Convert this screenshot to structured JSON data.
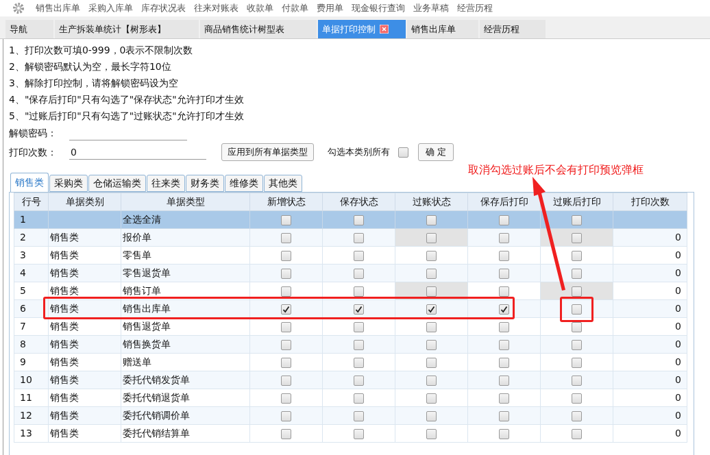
{
  "menu": [
    "销售出库单",
    "采购入库单",
    "库存状况表",
    "往来对账表",
    "收款单",
    "付款单",
    "费用单",
    "现金银行查询",
    "业务草稿",
    "经营历程"
  ],
  "tabs": [
    {
      "label": "导航",
      "selected": false,
      "closable": false
    },
    {
      "label": "生产拆装单统计【树形表】",
      "selected": false,
      "closable": false
    },
    {
      "label": "商品销售统计树型表",
      "selected": false,
      "closable": false
    },
    {
      "label": "单据打印控制",
      "selected": true,
      "closable": true
    },
    {
      "label": "销售出库单",
      "selected": false,
      "closable": false
    },
    {
      "label": "经营历程",
      "selected": false,
      "closable": false
    }
  ],
  "notes": [
    "1、打印次数可填0-999，0表示不限制次数",
    "2、解锁密码默认为空，最长字符10位",
    "3、解除打印控制，请将解锁密码设为空",
    "4、\"保存后打印\"只有勾选了\"保存状态\"允许打印才生效",
    "5、\"过账后打印\"只有勾选了\"过账状态\"允许打印才生效"
  ],
  "password": {
    "label": "解锁密码："
  },
  "print_count": {
    "label": "打印次数：",
    "value": "0"
  },
  "apply_button": "应用到所有单据类型",
  "select_all": {
    "label": "勾选本类别所有",
    "checked": false
  },
  "ok_button": "确 定",
  "category_tabs": [
    {
      "label": "销售类",
      "selected": true
    },
    {
      "label": "采购类",
      "selected": false
    },
    {
      "label": "仓储运输类",
      "selected": false
    },
    {
      "label": "往来类",
      "selected": false
    },
    {
      "label": "财务类",
      "selected": false
    },
    {
      "label": "维修类",
      "selected": false
    },
    {
      "label": "其他类",
      "selected": false
    }
  ],
  "table": {
    "columns": [
      "行号",
      "单据类别",
      "单据类型",
      "新增状态",
      "保存状态",
      "过账状态",
      "保存后打印",
      "过账后打印",
      "打印次数"
    ],
    "rows": [
      {
        "no": "1",
        "category": "",
        "type": "全选全清",
        "selected": true,
        "checks": [
          {
            "checked": false,
            "disabled": false
          },
          {
            "checked": false,
            "disabled": false
          },
          {
            "checked": false,
            "disabled": false
          },
          {
            "checked": false,
            "disabled": false
          },
          {
            "checked": false,
            "disabled": false
          }
        ],
        "count": ""
      },
      {
        "no": "2",
        "category": "销售类",
        "type": "报价单",
        "selected": false,
        "checks": [
          {
            "checked": false,
            "disabled": false
          },
          {
            "checked": false,
            "disabled": false
          },
          {
            "checked": false,
            "disabled": true
          },
          {
            "checked": false,
            "disabled": false
          },
          {
            "checked": false,
            "disabled": true
          }
        ],
        "count": "0"
      },
      {
        "no": "3",
        "category": "销售类",
        "type": "零售单",
        "selected": false,
        "checks": [
          {
            "checked": false,
            "disabled": false
          },
          {
            "checked": false,
            "disabled": false
          },
          {
            "checked": false,
            "disabled": false
          },
          {
            "checked": false,
            "disabled": false
          },
          {
            "checked": false,
            "disabled": false
          }
        ],
        "count": "0"
      },
      {
        "no": "4",
        "category": "销售类",
        "type": "零售退货单",
        "selected": false,
        "checks": [
          {
            "checked": false,
            "disabled": false
          },
          {
            "checked": false,
            "disabled": false
          },
          {
            "checked": false,
            "disabled": false
          },
          {
            "checked": false,
            "disabled": false
          },
          {
            "checked": false,
            "disabled": false
          }
        ],
        "count": "0"
      },
      {
        "no": "5",
        "category": "销售类",
        "type": "销售订单",
        "selected": false,
        "checks": [
          {
            "checked": false,
            "disabled": false
          },
          {
            "checked": false,
            "disabled": false
          },
          {
            "checked": false,
            "disabled": true
          },
          {
            "checked": false,
            "disabled": false
          },
          {
            "checked": false,
            "disabled": true
          }
        ],
        "count": "0"
      },
      {
        "no": "6",
        "category": "销售类",
        "type": "销售出库单",
        "selected": false,
        "checks": [
          {
            "checked": true,
            "disabled": false
          },
          {
            "checked": true,
            "disabled": false
          },
          {
            "checked": true,
            "disabled": false
          },
          {
            "checked": true,
            "disabled": false
          },
          {
            "checked": false,
            "disabled": false
          }
        ],
        "count": "0"
      },
      {
        "no": "7",
        "category": "销售类",
        "type": "销售退货单",
        "selected": false,
        "checks": [
          {
            "checked": false,
            "disabled": false
          },
          {
            "checked": false,
            "disabled": false
          },
          {
            "checked": false,
            "disabled": false
          },
          {
            "checked": false,
            "disabled": false
          },
          {
            "checked": false,
            "disabled": false
          }
        ],
        "count": "0"
      },
      {
        "no": "8",
        "category": "销售类",
        "type": "销售换货单",
        "selected": false,
        "checks": [
          {
            "checked": false,
            "disabled": false
          },
          {
            "checked": false,
            "disabled": false
          },
          {
            "checked": false,
            "disabled": false
          },
          {
            "checked": false,
            "disabled": false
          },
          {
            "checked": false,
            "disabled": false
          }
        ],
        "count": "0"
      },
      {
        "no": "9",
        "category": "销售类",
        "type": "赠送单",
        "selected": false,
        "checks": [
          {
            "checked": false,
            "disabled": false
          },
          {
            "checked": false,
            "disabled": false
          },
          {
            "checked": false,
            "disabled": false
          },
          {
            "checked": false,
            "disabled": false
          },
          {
            "checked": false,
            "disabled": false
          }
        ],
        "count": "0"
      },
      {
        "no": "10",
        "category": "销售类",
        "type": "委托代销发货单",
        "selected": false,
        "checks": [
          {
            "checked": false,
            "disabled": false
          },
          {
            "checked": false,
            "disabled": false
          },
          {
            "checked": false,
            "disabled": false
          },
          {
            "checked": false,
            "disabled": false
          },
          {
            "checked": false,
            "disabled": false
          }
        ],
        "count": "0"
      },
      {
        "no": "11",
        "category": "销售类",
        "type": "委托代销退货单",
        "selected": false,
        "checks": [
          {
            "checked": false,
            "disabled": false
          },
          {
            "checked": false,
            "disabled": false
          },
          {
            "checked": false,
            "disabled": false
          },
          {
            "checked": false,
            "disabled": false
          },
          {
            "checked": false,
            "disabled": false
          }
        ],
        "count": "0"
      },
      {
        "no": "12",
        "category": "销售类",
        "type": "委托代销调价单",
        "selected": false,
        "checks": [
          {
            "checked": false,
            "disabled": false
          },
          {
            "checked": false,
            "disabled": false
          },
          {
            "checked": false,
            "disabled": false
          },
          {
            "checked": false,
            "disabled": false
          },
          {
            "checked": false,
            "disabled": false
          }
        ],
        "count": "0"
      },
      {
        "no": "13",
        "category": "销售类",
        "type": "委托代销结算单",
        "selected": false,
        "checks": [
          {
            "checked": false,
            "disabled": false
          },
          {
            "checked": false,
            "disabled": false
          },
          {
            "checked": false,
            "disabled": false
          },
          {
            "checked": false,
            "disabled": false
          },
          {
            "checked": false,
            "disabled": false
          }
        ],
        "count": "0"
      }
    ]
  },
  "annotation": {
    "text": "取消勾选过账后不会有打印预览弹框"
  }
}
